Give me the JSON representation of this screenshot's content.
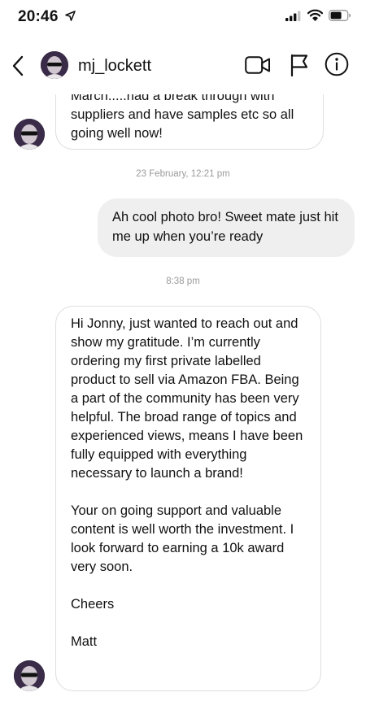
{
  "status_bar": {
    "time": "20:46"
  },
  "header": {
    "username": "mj_lockett"
  },
  "thread": {
    "messages": [
      {
        "direction": "incoming",
        "text": "March.....had a break through with\nsuppliers and have samples etc so all\ngoing well now!"
      },
      {
        "direction": "outgoing",
        "text": "Ah cool photo bro! Sweet mate just hit me up when you’re ready"
      },
      {
        "direction": "incoming",
        "paragraphs": [
          "Hi Jonny, just wanted to reach out and show my gratitude. I’m currently ordering my first private labelled product to sell via Amazon FBA. Being a part of the community has been very helpful. The broad range of topics and experienced views, means I have been fully equipped with everything necessary to launch a brand!",
          "Your on going support and valuable content is well worth the investment. I look forward to earning a 10k award very soon.",
          "Cheers",
          "Matt"
        ]
      }
    ],
    "timestamps": [
      "23 February, 12:21 pm",
      "8:38 pm"
    ]
  },
  "icons": {
    "location": "location-arrow-icon",
    "signal": "cellular-signal-icon",
    "wifi": "wifi-icon",
    "battery": "battery-icon",
    "back": "chevron-left-icon",
    "video": "video-camera-icon",
    "flag": "flag-icon",
    "info": "info-icon"
  },
  "colors": {
    "outgoing_bubble": "#efefef",
    "incoming_border": "#dedede",
    "timestamp": "#9a9a9a"
  }
}
